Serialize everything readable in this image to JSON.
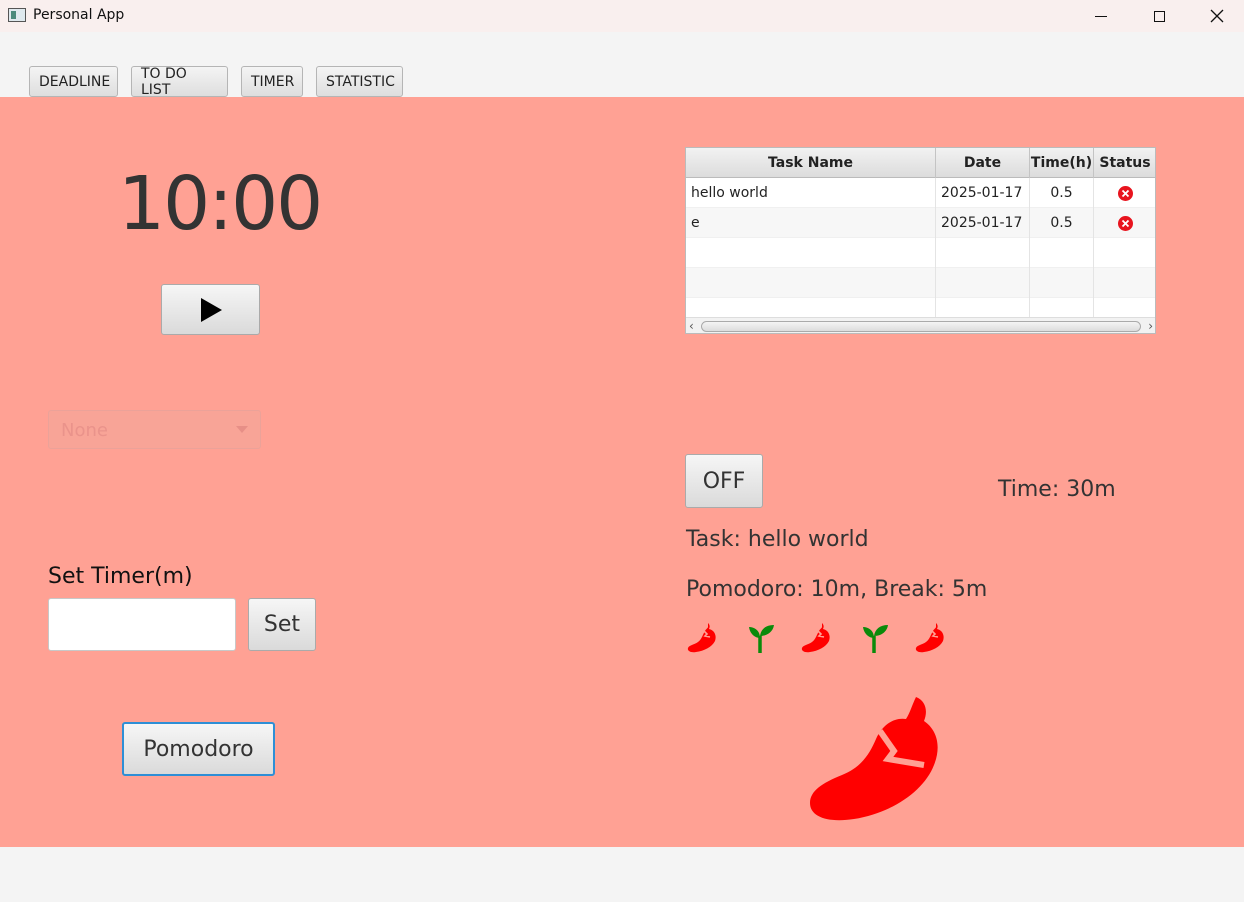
{
  "window": {
    "title": "Personal App"
  },
  "nav": {
    "tabs": [
      "DEADLINE",
      "TO DO LIST",
      "TIMER",
      "STATISTIC"
    ]
  },
  "timer": {
    "display": "10:00",
    "play_icon": "play-icon",
    "task_select_value": "None",
    "set_label": "Set Timer(m)",
    "set_input_value": "",
    "set_button": "Set",
    "pomodoro_button": "Pomodoro"
  },
  "table": {
    "columns": [
      "Task Name",
      "Date",
      "Time(h)",
      "Status"
    ],
    "rows": [
      {
        "name": "hello world",
        "date": "2025-01-17",
        "time": "0.5",
        "status": "incomplete-icon"
      },
      {
        "name": "e",
        "date": "2025-01-17",
        "time": "0.5",
        "status": "incomplete-icon"
      }
    ]
  },
  "session": {
    "toggle_label": "OFF",
    "time_text": "Time: 30m",
    "task_text": "Task: hello world",
    "pomodoro_text": "Pomodoro: 10m, Break: 5m",
    "sequence": [
      "chili-icon",
      "sprout-icon",
      "chili-icon",
      "sprout-icon",
      "chili-icon"
    ],
    "current_icon": "chili-icon"
  },
  "colors": {
    "main_bg": "#ffa194",
    "chili": "#ff0000",
    "sprout": "#0a8a0a",
    "status_x": "#e8141e"
  }
}
